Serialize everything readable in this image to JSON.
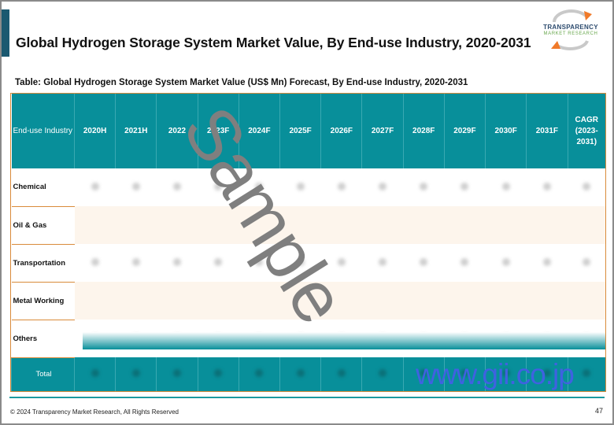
{
  "header": {
    "title": "Global Hydrogen Storage System Market Value, By End-use Industry, 2020-2031",
    "logo": {
      "line1": "TRANSPARENCY",
      "line2": "MARKET RESEARCH",
      "icon": "arrow-cycle-icon"
    }
  },
  "table": {
    "caption": "Table: Global Hydrogen Storage System Market Value (US$ Mn) Forecast, By End-use Industry, 2020-2031",
    "columns": [
      "End-use Industry",
      "2020H",
      "2021H",
      "2022",
      "2023F",
      "2024F",
      "2025F",
      "2026F",
      "2027F",
      "2028F",
      "2029F",
      "2030F",
      "2031F",
      "CAGR (2023-2031)"
    ],
    "rows": [
      {
        "label": "Chemical"
      },
      {
        "label": "Oil & Gas"
      },
      {
        "label": "Transportation"
      },
      {
        "label": "Metal Working"
      },
      {
        "label": "Others"
      }
    ],
    "total_label": "Total",
    "values_note": "blurred"
  },
  "watermarks": {
    "sample": "Sample",
    "site": "www.gii.co.jp"
  },
  "footer": {
    "copyright": "© 2024 Transparency Market Research, All Rights Reserved",
    "page_number": "47"
  },
  "colors": {
    "header_teal": "#088f9a",
    "accent_orange": "#d98b3a",
    "title_bar": "#1b5970",
    "gii_blue": "#3f62e0"
  }
}
